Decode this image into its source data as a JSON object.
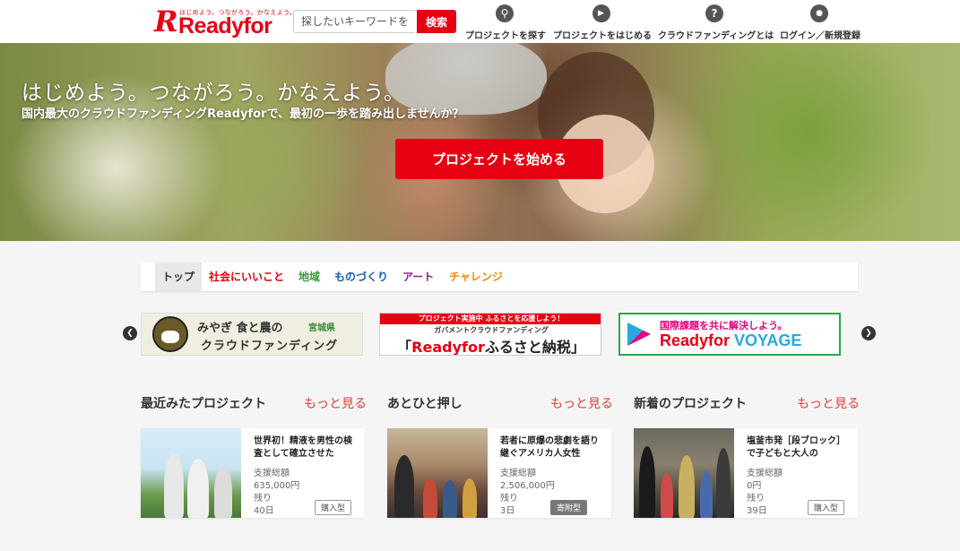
{
  "header": {
    "logo_letter": "R",
    "logo_tagline": "はじめよう。つながろう。かなえよう。",
    "logo_name": "Readyfor",
    "search_placeholder": "探したいキーワードを入力",
    "search_button": "検索",
    "nav": [
      {
        "label": "プロジェクトを探す",
        "icon": "search-icon",
        "glyph": "⚲"
      },
      {
        "label": "プロジェクトをはじめる",
        "icon": "play-icon",
        "glyph": "▶"
      },
      {
        "label": "クラウドファンディングとは",
        "icon": "question-icon",
        "glyph": "?"
      },
      {
        "label": "ログイン／新規登録",
        "icon": "user-icon",
        "glyph": "●"
      }
    ]
  },
  "hero": {
    "title": "はじめよう。つながろう。かなえよう。",
    "subtitle": "国内最大のクラウドファンディングReadyforで、最初の一歩を踏み出しませんか？",
    "cta": "プロジェクトを始める"
  },
  "tabs": [
    {
      "label": "トップ",
      "color": "#333333"
    },
    {
      "label": "社会にいいこと",
      "color": "#e60012"
    },
    {
      "label": "地域",
      "color": "#3a9a3a"
    },
    {
      "label": "ものづくり",
      "color": "#1a5fb4"
    },
    {
      "label": "アート",
      "color": "#8a1a8a"
    },
    {
      "label": "チャレンジ",
      "color": "#f08c00"
    }
  ],
  "banners": {
    "prev_glyph": "❮",
    "next_glyph": "❯",
    "miyagi": {
      "line1": "みやぎ 食と農の",
      "pref": "宮城県",
      "line2": "クラウドファンディング"
    },
    "furusato": {
      "top": "プロジェクト実施中 ふるさとを応援しよう！",
      "mid": "ガバメントクラウドファンディング",
      "main_open": "「",
      "main_brand": "Readyfor",
      "main_rest": "ふるさと納税」"
    },
    "voyage": {
      "top": "国際課題を共に解決しよう。",
      "brand": "Readyfor ",
      "voyage": "VOYAGE"
    }
  },
  "sections": [
    {
      "title": "最近みたプロジェクト",
      "more": "もっと見る",
      "card": {
        "title": "世界初！精液を男性の検査として確立させた",
        "l1": "支援総額",
        "v1": "635,000円",
        "l2": "残り",
        "v2": "40日",
        "badge": "購入型"
      }
    },
    {
      "title": "あとひと押し",
      "more": "もっと見る",
      "card": {
        "title": "若者に原爆の悲劇を語り継ぐアメリカ人女性",
        "l1": "支援総額",
        "v1": "2,506,000円",
        "l2": "残り",
        "v2": "3日",
        "badge": "寄附型"
      }
    },
    {
      "title": "新着のプロジェクト",
      "more": "もっと見る",
      "card": {
        "title": "塩釜市発［段ブロック］で子どもと大人の",
        "l1": "支援総額",
        "v1": "0円",
        "l2": "残り",
        "v2": "39日",
        "badge": "購入型"
      }
    }
  ]
}
